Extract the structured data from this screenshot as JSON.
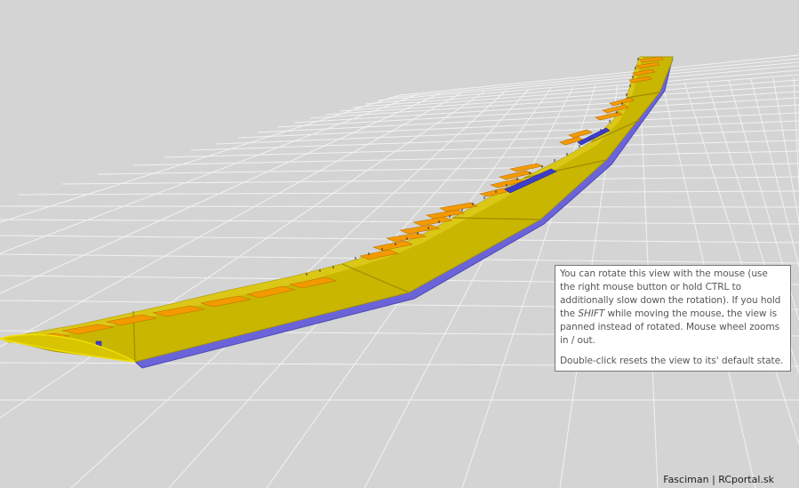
{
  "viewer": {
    "colors": {
      "background": "#d4d4d4",
      "grid": "#ffffff",
      "wing_skin": "#c8b400",
      "wing_rib": "#f39a00",
      "spar": "#5a52c8"
    }
  },
  "tooltip": {
    "line_a": "You can rotate this view with the mouse (use the right mouse button or hold CTRL to additionally slow down the rotation). If you hold the ",
    "line_em": "SHIFT",
    "line_b": " while moving the mouse, the view is panned instead of rotated. Mouse wheel zooms in / out.",
    "line_2": "Double-click resets the view to its' default state."
  },
  "credit": "Fasciman | RCportal.sk"
}
